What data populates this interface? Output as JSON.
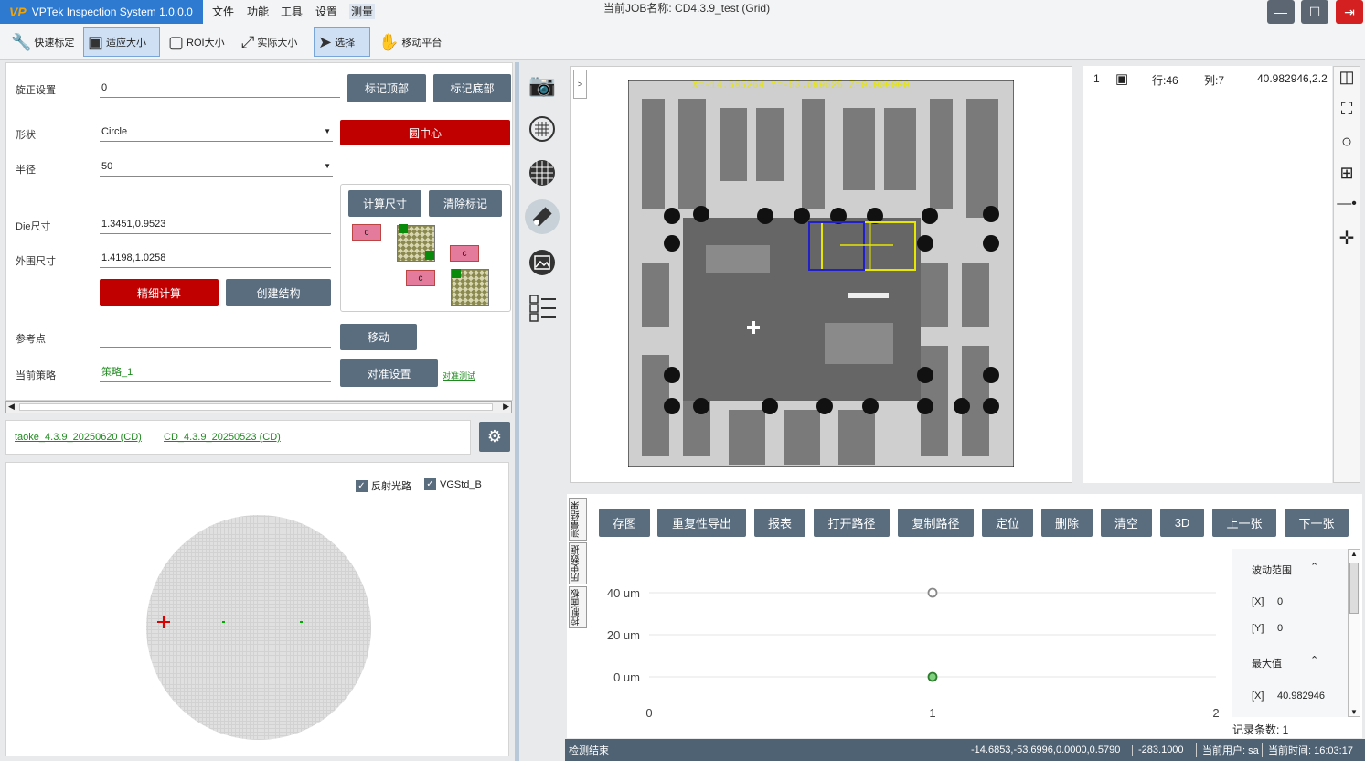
{
  "app": {
    "logo": "VP",
    "title": "VPTek Inspection System 1.0.0.0",
    "menu": [
      "文件",
      "功能",
      "工具",
      "设置",
      "测量"
    ],
    "job_label": "当前JOB名称:",
    "job_name": "CD4.3.9_test (Grid)",
    "window_buttons": [
      "minimize-icon",
      "maximize-icon",
      "exit-icon"
    ]
  },
  "toolbar": {
    "items": [
      {
        "label": "快速标定",
        "icon": "wrench-icon"
      },
      {
        "label": "适应大小",
        "icon": "fit-size-icon",
        "active": true
      },
      {
        "label": "ROI大小",
        "icon": "roi-rect-icon"
      },
      {
        "label": "实际大小",
        "icon": "expand-icon"
      },
      {
        "label": "选择",
        "icon": "cursor-icon",
        "active": true
      },
      {
        "label": "移动平台",
        "icon": "hand-icon"
      }
    ]
  },
  "left": {
    "rotation_label": "旋正设置",
    "rotation_value": "0",
    "mark_top": "标记顶部",
    "mark_bottom": "标记底部",
    "shape_label": "形状",
    "shape_value": "Circle",
    "circle_center": "圆中心",
    "radius_label": "半径",
    "radius_value": "50",
    "calc_size": "计算尺寸",
    "clear_mark": "清除标记",
    "die_label": "Die尺寸",
    "die_value": "1.3451,0.9523",
    "outer_label": "外围尺寸",
    "outer_value": "1.4198,1.0258",
    "fine_calc": "精细计算",
    "create_struct": "创建结构",
    "ref_label": "参考点",
    "ref_value": "",
    "move": "移动",
    "strategy_label": "当前策略",
    "strategy_value": "策略_1",
    "align_settings": "对准设置",
    "align_test": "对准测试",
    "c_label": "c"
  },
  "jobs": {
    "tabs": [
      "taoke_4.3.9_20250620 (CD)",
      "CD_4.3.9_20250523 (CD)"
    ]
  },
  "wafer": {
    "checks": [
      {
        "label": "反射光路",
        "checked": true
      },
      {
        "label": "VGStd_B",
        "checked": true
      }
    ]
  },
  "side_icons": [
    "camera-icon",
    "wafer-map-icon",
    "grid-icon",
    "calibrate-icon",
    "image-gallery-icon",
    "checklist-icon"
  ],
  "image": {
    "expand_label": ">",
    "overlay_text": "X=-14.685264 Y=-53.699625 Z=0.000000"
  },
  "info": {
    "index": "1",
    "row": "行:46",
    "col": "列:7",
    "value": "40.982946,2.2"
  },
  "right_tools": [
    "crosshair-frame-icon",
    "fullscreen-icon",
    "circle-icon",
    "zoom-fit-icon",
    "line-point-icon",
    "move-cross-icon"
  ],
  "bottom": {
    "tabs": [
      "测量结果",
      "历史数据",
      "控制面板"
    ],
    "buttons": [
      "存图",
      "重复性导出",
      "报表",
      "打开路径",
      "复制路径",
      "定位",
      "删除",
      "清空",
      "3D",
      "上一张",
      "下一张"
    ],
    "range_title": "波动范围",
    "range_x_label": "[X]",
    "range_x": "0",
    "range_y_label": "[Y]",
    "range_y": "0",
    "max_title": "最大值",
    "max_x_label": "[X]",
    "max_x": "40.982946",
    "record_count": "记录条数: 1"
  },
  "chart_data": {
    "type": "scatter",
    "x_ticks": [
      "0",
      "1",
      "2"
    ],
    "y_ticks": [
      "0 um",
      "20 um",
      "40 um"
    ],
    "xlim": [
      0,
      2
    ],
    "ylim": [
      0,
      40
    ],
    "series": [
      {
        "points": [
          {
            "x": 1,
            "y": 40
          }
        ],
        "color": "#888888",
        "style": "hollow"
      },
      {
        "points": [
          {
            "x": 1,
            "y": 0
          }
        ],
        "color": "#2e9e2e",
        "style": "filled"
      }
    ],
    "grid": true
  },
  "status": {
    "left": "检测结束",
    "coords": "-14.6853,-53.6996,0.0000,0.5790",
    "z": "-283.1000",
    "user": "当前用户: sa",
    "time": "当前时间: 16:03:17"
  },
  "colors": {
    "accent": "#2e7ad1",
    "danger": "#c00000",
    "button": "#5a6d7f",
    "status": "#4f6273"
  }
}
